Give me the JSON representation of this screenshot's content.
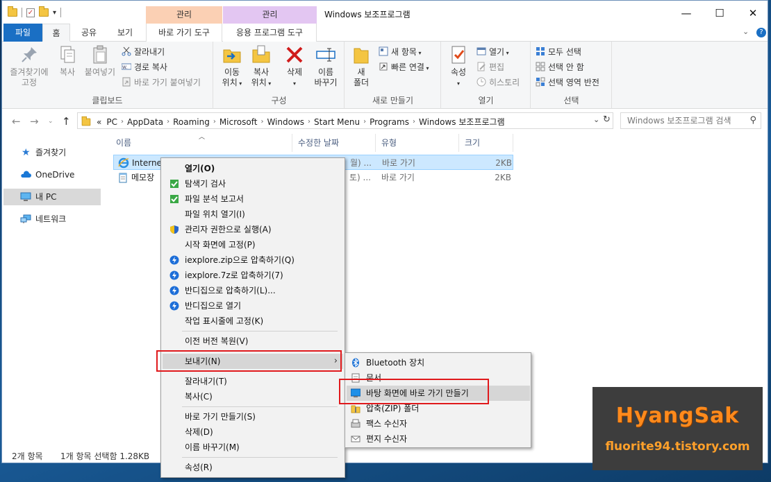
{
  "window": {
    "title": "Windows 보조프로그램",
    "context_tabs": {
      "manage1": "관리",
      "manage2": "관리"
    },
    "controls": {
      "minimize": "—",
      "maximize": "☐",
      "close": "✕"
    }
  },
  "ribbon_tabs": {
    "file": "파일",
    "home": "홈",
    "share": "공유",
    "view": "보기",
    "shortcut_tools": "바로 가기 도구",
    "app_tools": "응용 프로그램 도구",
    "help": "?"
  },
  "ribbon": {
    "clipboard": {
      "label": "클립보드",
      "pin": "즐겨찾기에\n고정",
      "pin_l1": "즐겨찾기에",
      "pin_l2": "고정",
      "copy": "복사",
      "paste": "붙여넣기",
      "cut": "잘라내기",
      "copy_path": "경로 복사",
      "paste_shortcut": "바로 가기 붙여넣기"
    },
    "organize": {
      "label": "구성",
      "move_l1": "이동",
      "move_l2": "위치",
      "copyto_l1": "복사",
      "copyto_l2": "위치",
      "delete": "삭제",
      "rename_l1": "이름",
      "rename_l2": "바꾸기"
    },
    "new": {
      "label": "새로 만들기",
      "folder_l1": "새",
      "folder_l2": "폴더",
      "new_item": "새 항목",
      "easy_access": "빠른 연결"
    },
    "open": {
      "label": "열기",
      "properties": "속성",
      "open": "열기",
      "edit": "편집",
      "history": "히스토리"
    },
    "select": {
      "label": "선택",
      "select_all": "모두 선택",
      "select_none": "선택 안 함",
      "invert": "선택 영역 반전"
    }
  },
  "address": {
    "breadcrumbs": [
      "«",
      "PC",
      "AppData",
      "Roaming",
      "Microsoft",
      "Windows",
      "Start Menu",
      "Programs",
      "Windows 보조프로그램"
    ],
    "search_placeholder": "Windows 보조프로그램 검색"
  },
  "nav": {
    "items": [
      {
        "label": "즐겨찾기",
        "icon": "star-icon"
      },
      {
        "label": "OneDrive",
        "icon": "cloud-icon"
      },
      {
        "label": "내 PC",
        "icon": "pc-icon"
      },
      {
        "label": "네트워크",
        "icon": "network-icon"
      }
    ]
  },
  "file_list": {
    "columns": [
      "이름",
      "수정한 날짜",
      "유형",
      "크기"
    ],
    "rows": [
      {
        "name": "Internet",
        "date": "월) ...",
        "type": "바로 가기",
        "size": "2KB"
      },
      {
        "name": "메모장",
        "date": "토) ...",
        "type": "바로 가기",
        "size": "2KB"
      }
    ]
  },
  "status": {
    "count": "2개 항목",
    "selected": "1개 항목 선택함 1.28KB"
  },
  "context_menu": {
    "items": [
      "열기(O)",
      "탐색기 검사",
      "파일 분석 보고서",
      "파일 위치 열기(I)",
      "관리자 권한으로 실행(A)",
      "시작 화면에 고정(P)",
      "iexplore.zip으로 압축하기(Q)",
      "iexplore.7z로 압축하기(7)",
      "반디집으로 압축하기(L)...",
      "반디집으로 열기",
      "작업 표시줄에 고정(K)",
      "이전 버전 복원(V)",
      "보내기(N)",
      "잘라내기(T)",
      "복사(C)",
      "바로 가기 만들기(S)",
      "삭제(D)",
      "이름 바꾸기(M)",
      "속성(R)"
    ]
  },
  "send_to_menu": {
    "items": [
      "Bluetooth 장치",
      "문서",
      "바탕 화면에 바로 가기 만들기",
      "압축(ZIP) 폴더",
      "팩스 수신자",
      "편지 수신자"
    ]
  },
  "watermark": {
    "line1": "HyangSak",
    "line2": "fluorite94.tistory.com"
  },
  "colors": {
    "accent": "#1a6fc4",
    "highlight_box": "#e0191c",
    "selection": "#cce8ff",
    "manage1_bg": "#fbd0b4",
    "manage2_bg": "#e3c6f2",
    "watermark_text": "#ff8a1c"
  }
}
